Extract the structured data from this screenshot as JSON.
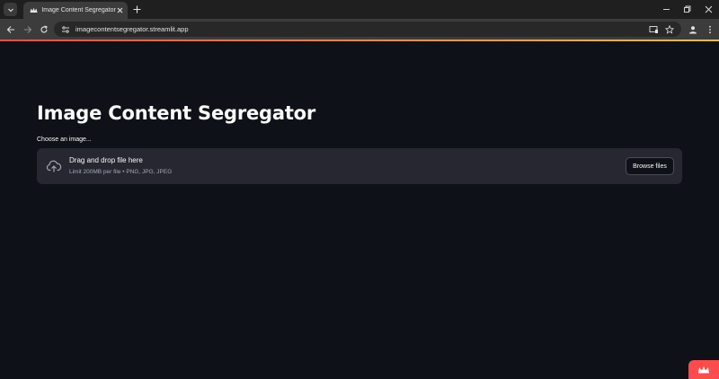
{
  "browser": {
    "tab_title": "Image Content Segregator · Streamlit",
    "url": "imagecontentsegregator.streamlit.app"
  },
  "page": {
    "title": "Image Content Segregator",
    "uploader": {
      "label": "Choose an image...",
      "drop_title": "Drag and drop file here",
      "limit_text": "Limit 200MB per file • PNG, JPG, JPEG",
      "browse_label": "Browse files"
    }
  },
  "colors": {
    "background": "#0e1117",
    "dropzone": "#262730",
    "accent": "#ff4b4b"
  }
}
